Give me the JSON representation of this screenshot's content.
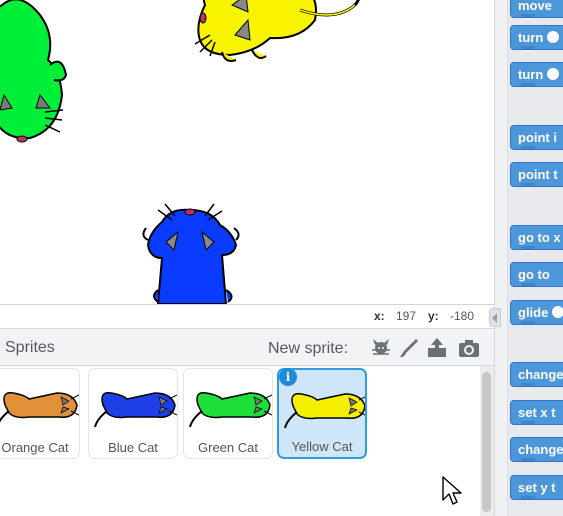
{
  "coordinates": {
    "x_label": "x:",
    "x_value": "197",
    "y_label": "y:",
    "y_value": "-180"
  },
  "sprites_panel": {
    "title": "Sprites",
    "new_sprite_label": "New sprite:",
    "new_sprite_icons": [
      "sprite-library-icon",
      "paint-brush-icon",
      "upload-sprite-icon",
      "camera-icon"
    ],
    "sprites": [
      {
        "name": "Orange Cat",
        "color": "#e0913a"
      },
      {
        "name": "Blue Cat",
        "color": "#1f3fe6"
      },
      {
        "name": "Green Cat",
        "color": "#1fe03a"
      },
      {
        "name": "Yellow Cat",
        "color": "#f4f000"
      }
    ],
    "selected_sprite": "Yellow Cat",
    "info_label": "i"
  },
  "palette": {
    "blocks": [
      "move",
      "turn",
      "turn",
      "point i",
      "point t",
      "go to x",
      "go to",
      "glide",
      "change",
      "set x t",
      "change",
      "set y t"
    ]
  },
  "colors": {
    "motion_block": "#4c97d9",
    "selection": "#2f9be0"
  }
}
